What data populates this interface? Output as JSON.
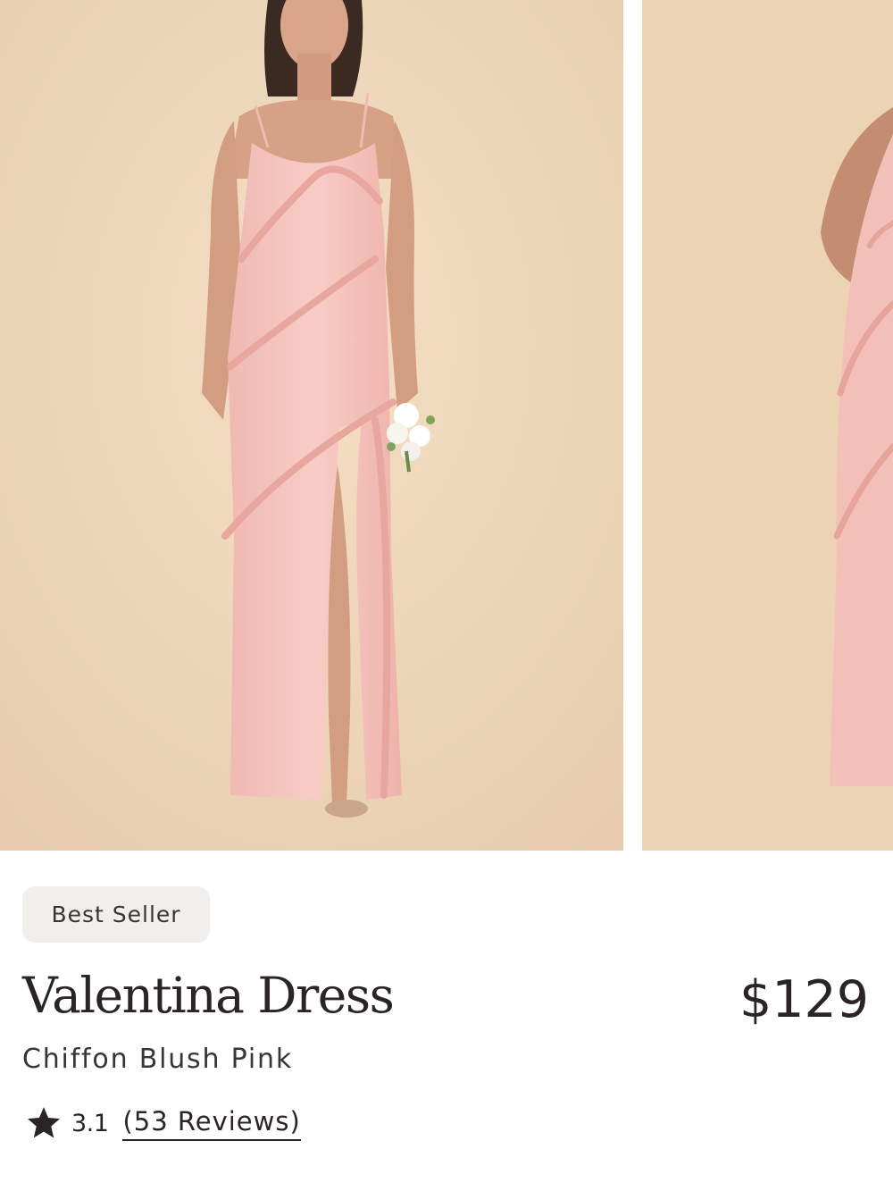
{
  "product": {
    "badge": "Best Seller",
    "name": "Valentina Dress",
    "price": "$129",
    "variant": "Chiffon Blush Pink",
    "rating": "3.1",
    "reviews_label": "(53 Reviews)",
    "rating_icon": "star-icon"
  },
  "gallery": {
    "images": [
      {
        "subject": "model-front-view"
      },
      {
        "subject": "model-side-view"
      }
    ]
  },
  "colors": {
    "backdrop": "#eed6b9",
    "dress": "#f5c5bf",
    "text": "#2b2424",
    "badge_bg": "#f1efec"
  }
}
